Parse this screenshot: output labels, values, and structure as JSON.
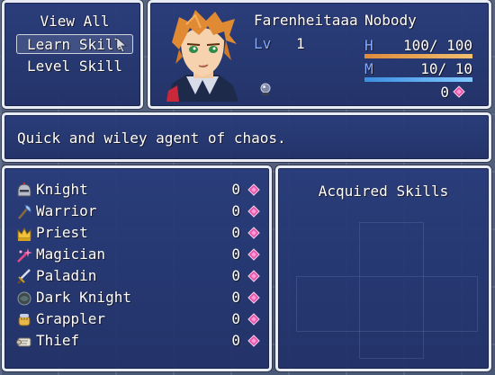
{
  "menu": {
    "items": [
      {
        "label": "View All",
        "selected": false
      },
      {
        "label": "Learn Skill",
        "selected": true
      },
      {
        "label": "Level Skill",
        "selected": false
      }
    ]
  },
  "actor": {
    "name": "Farenheitaaa",
    "class": "Nobody",
    "level_label": "Lv",
    "level": "1",
    "hp_label": "H",
    "hp": "100/ 100",
    "hp_fraction": 1.0,
    "mp_label": "M",
    "mp": "10/ 10",
    "mp_fraction": 1.0,
    "jp_total": "0"
  },
  "help": {
    "text": "Quick and wiley agent of chaos."
  },
  "classes": [
    {
      "name": "Knight",
      "jp": "0",
      "icon": "helmet-icon"
    },
    {
      "name": "Warrior",
      "jp": "0",
      "icon": "axe-icon"
    },
    {
      "name": "Priest",
      "jp": "0",
      "icon": "crown-icon"
    },
    {
      "name": "Magician",
      "jp": "0",
      "icon": "magic-burst-icon"
    },
    {
      "name": "Paladin",
      "jp": "0",
      "icon": "sword-icon"
    },
    {
      "name": "Dark Knight",
      "jp": "0",
      "icon": "dark-orb-icon"
    },
    {
      "name": "Grappler",
      "jp": "0",
      "icon": "fist-icon"
    },
    {
      "name": "Thief",
      "jp": "0",
      "icon": "scroll-icon"
    }
  ],
  "skills_panel": {
    "title": "Acquired Skills"
  },
  "colors": {
    "hp_gauge": "#e08a3c",
    "mp_gauge": "#3c8ee0",
    "system_label": "#84aaff",
    "jp_gem": "#e64fa8"
  }
}
